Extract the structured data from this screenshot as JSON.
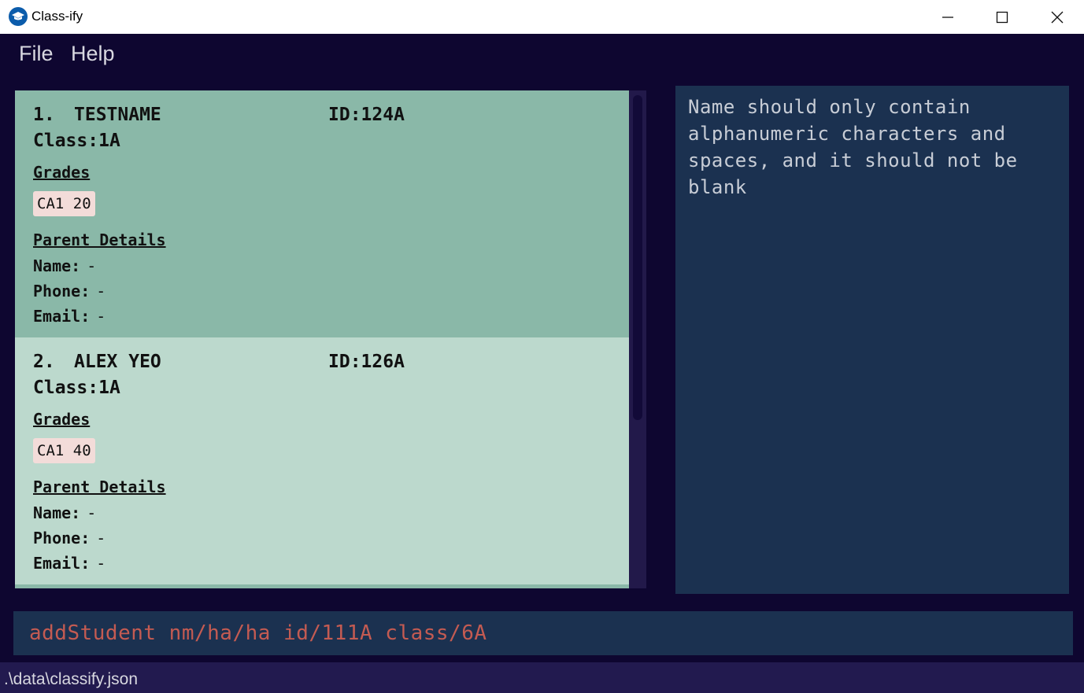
{
  "window": {
    "title": "Class-ify",
    "icon": "graduation-cap-icon",
    "controls": [
      "minimize-icon",
      "maximize-icon",
      "close-icon"
    ]
  },
  "menu": {
    "file": "File",
    "help": "Help"
  },
  "students": [
    {
      "index": "1.",
      "name": "TESTNAME",
      "id_label": "ID:",
      "id": "124A",
      "class_label": "Class:",
      "class": "1A",
      "grades_heading": "Grades",
      "grades": [
        "CA1 20"
      ],
      "parent_heading": "Parent Details",
      "parent_name_label": "Name:",
      "parent_name": "-",
      "parent_phone_label": "Phone:",
      "parent_phone": "-",
      "parent_email_label": "Email:",
      "parent_email": "-"
    },
    {
      "index": "2.",
      "name": "ALEX YEO",
      "id_label": "ID:",
      "id": "126A",
      "class_label": "Class:",
      "class": "1A",
      "grades_heading": "Grades",
      "grades": [
        "CA1 40"
      ],
      "parent_heading": "Parent Details",
      "parent_name_label": "Name:",
      "parent_name": "-",
      "parent_phone_label": "Phone:",
      "parent_phone": "-",
      "parent_email_label": "Email:",
      "parent_email": "-"
    }
  ],
  "result": {
    "message": "Name should only contain alphanumeric characters and spaces, and it should not be blank"
  },
  "command": {
    "value": "addStudent nm/ha/ha id/111A class/6A"
  },
  "status": {
    "path": ".\\data\\classify.json"
  },
  "colors": {
    "background": "#0e0630",
    "card_selected": "#8ab8a8",
    "card_normal": "#bcd9cd",
    "grade_tag": "#f3dcd9",
    "panel": "#1b3150",
    "command_text": "#c45b52"
  }
}
